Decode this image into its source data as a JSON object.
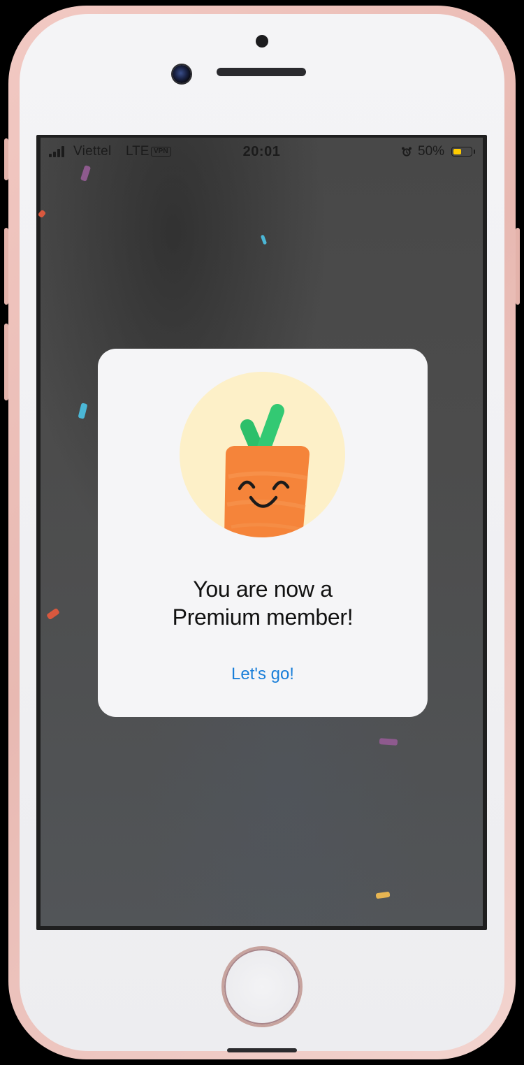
{
  "status_bar": {
    "carrier": "Viettel",
    "network": "LTE",
    "vpn": "VPN",
    "time": "20:01",
    "battery_percent": "50%",
    "battery_level": 0.5,
    "battery_color": "#ffcc00",
    "alarm_icon": "alarm-clock-icon"
  },
  "modal": {
    "title_line1": "You are now a",
    "title_line2": "Premium member!",
    "cta_label": "Let's go!",
    "cta_color": "#1a7fd9",
    "mascot_icon": "carrot-mascot-icon"
  },
  "colors": {
    "mascot_bg": "#fdf0c8",
    "carrot_orange": "#f5843a",
    "carrot_leaf": "#2dbf6a",
    "device_rose_gold": "#f2c9c3"
  }
}
